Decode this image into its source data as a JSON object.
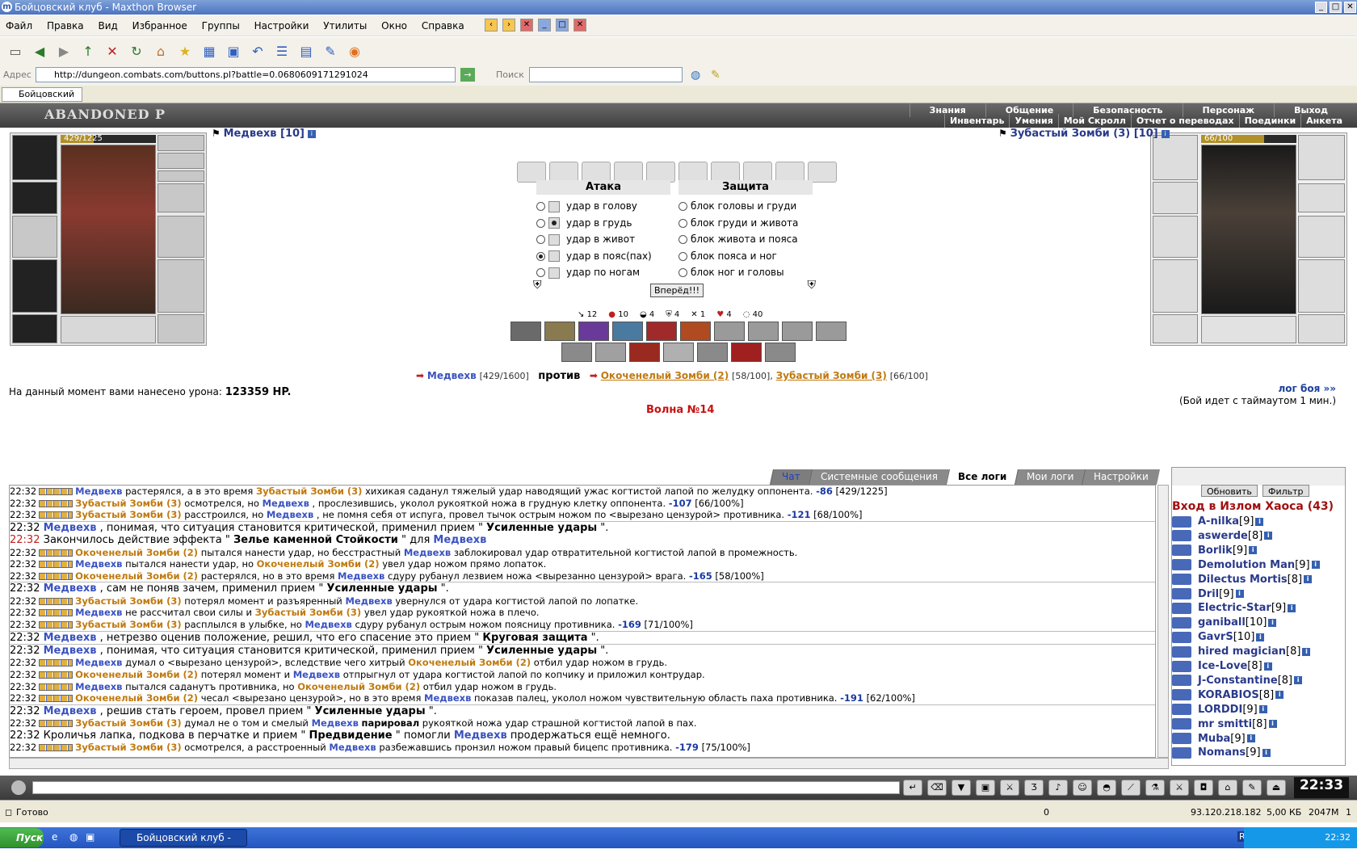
{
  "window": {
    "title": "Бойцовский клуб - Maxthon Browser",
    "app_icon": "maxthon-icon"
  },
  "menu": [
    "Файл",
    "Правка",
    "Вид",
    "Избранное",
    "Группы",
    "Настройки",
    "Утилиты",
    "Окно",
    "Справка"
  ],
  "address": {
    "label": "Адрес",
    "url": "http://dungeon.combats.com/buttons.pl?battle=0.0680609171291024",
    "search_label": "Поиск",
    "search_value": ""
  },
  "tab": {
    "label": "Бойцовский ..."
  },
  "game_header": {
    "logo": "ABANDONED P",
    "nav_top": [
      "Знания",
      "Общение",
      "Безопасность",
      "Персонаж",
      "Выход"
    ],
    "nav_bottom": [
      "Инвентарь",
      "Умения",
      "Мой Скролл",
      "Отчет о переводах",
      "Поединки",
      "Анкета"
    ]
  },
  "player": {
    "name": "Медвехв [10]",
    "hp": "429/1225",
    "hp_fraction": 0.35
  },
  "enemy": {
    "name": "Зубастый Зомби (3) [10]",
    "hp": "66/100",
    "hp_fraction": 0.66
  },
  "attack": {
    "title": "Атака",
    "options": [
      "удар в голову",
      "удар в грудь",
      "удар в живот",
      "удар в пояс(пах)",
      "удар по ногам"
    ],
    "selected": 3
  },
  "defense": {
    "title": "Защита",
    "options": [
      "блок головы и груди",
      "блок груди и живота",
      "блок живота и пояса",
      "блок пояса и ног",
      "блок ног и головы"
    ],
    "selected": -1
  },
  "go_button": "Вперёд!!!",
  "stats": [
    "12",
    "10",
    "4",
    "4",
    "1",
    "4",
    "40"
  ],
  "versus": {
    "player": "Медвехв",
    "player_hp": "[429/1600]",
    "vs": "против",
    "enemy1": "Окоченелый Зомби (2)",
    "enemy1_hp": "[58/100],",
    "enemy2": "Зубастый Зомби (3)",
    "enemy2_hp": "[66/100]"
  },
  "damage": {
    "label": "На данный момент вами нанесено урона:",
    "value": "123359 HP."
  },
  "wave": "Волна №14",
  "log_link": "лог боя »»",
  "timeout_text": "(Бой идет с таймаутом 1 мин.)",
  "chat_tabs": [
    "Чат",
    "Системные сообщения",
    "Все логи",
    "Мои логи",
    "Настройки"
  ],
  "chat_log": [
    {
      "t": "22:32",
      "sq": true,
      "parts": [
        [
          "b1",
          "Медвехв"
        ],
        [
          "",
          "растерялся, а в это время"
        ],
        [
          "b2",
          "Зубастый Зомби (3)"
        ],
        [
          "",
          "хихикая саданул тяжелый удар наводящий ужас когтистой лапой по желудку оппонента."
        ],
        [
          "dmg",
          "-86"
        ],
        [
          "",
          "[429/1225]"
        ]
      ]
    },
    {
      "t": "22:32",
      "sq": true,
      "parts": [
        [
          "b2",
          "Зубастый Зомби (3)"
        ],
        [
          "",
          "осмотрелся, но"
        ],
        [
          "b1",
          "Медвехв"
        ],
        [
          "",
          ", прослезившись, уколол рукояткой ножа в грудную клетку оппонента."
        ],
        [
          "dmg",
          "-107"
        ],
        [
          "",
          "[66/100%]"
        ]
      ]
    },
    {
      "t": "22:32",
      "sq": true,
      "parts": [
        [
          "b2",
          "Зубастый Зомби (3)"
        ],
        [
          "",
          "расстроился, но"
        ],
        [
          "b1",
          "Медвехв"
        ],
        [
          "",
          ", не помня себя от испуга, провел тычок острым ножом по <вырезано цензурой> противника."
        ],
        [
          "dmg",
          "-121"
        ],
        [
          "",
          "[68/100%]"
        ]
      ]
    },
    {
      "t": "22:32",
      "big": true,
      "sep": true,
      "parts": [
        [
          "b1",
          "Медвехв"
        ],
        [
          "",
          ", понимая, что ситуация становится критической, применил прием \""
        ],
        [
          "bk",
          "Усиленные удары"
        ],
        [
          "",
          "\"."
        ]
      ]
    },
    {
      "t": "22:32",
      "big": true,
      "red": true,
      "parts": [
        [
          "",
          "Закончилось действие эффекта \""
        ],
        [
          "bk",
          "Зелье каменной Стойкости"
        ],
        [
          "",
          "\" для"
        ],
        [
          "b1",
          "Медвехв"
        ]
      ]
    },
    {
      "t": "22:32",
      "sq": true,
      "parts": [
        [
          "b2",
          "Окоченелый Зомби (2)"
        ],
        [
          "",
          "пытался нанести удар, но бесстрастный"
        ],
        [
          "b1",
          "Медвехв"
        ],
        [
          "",
          "заблокировал удар отвратительной когтистой лапой в промежность."
        ]
      ]
    },
    {
      "t": "22:32",
      "sq": true,
      "parts": [
        [
          "b1",
          "Медвехв"
        ],
        [
          "",
          "пытался нанести удар, но"
        ],
        [
          "b2",
          "Окоченелый Зомби (2)"
        ],
        [
          "",
          "увел удар ножом прямо лопаток."
        ]
      ]
    },
    {
      "t": "22:32",
      "sq": true,
      "parts": [
        [
          "b2",
          "Окоченелый Зомби (2)"
        ],
        [
          "",
          "растерялся, но в это время"
        ],
        [
          "b1",
          "Медвехв"
        ],
        [
          "",
          "сдуру рубанул лезвием ножа <вырезанно цензурой> врага."
        ],
        [
          "dmg",
          "-165"
        ],
        [
          "",
          "[58/100%]"
        ]
      ]
    },
    {
      "t": "22:32",
      "big": true,
      "sep": true,
      "parts": [
        [
          "b1",
          "Медвехв"
        ],
        [
          "",
          ", сам не поняв зачем, применил прием \""
        ],
        [
          "bk",
          "Усиленные удары"
        ],
        [
          "",
          "\"."
        ]
      ]
    },
    {
      "t": "22:32",
      "sq": true,
      "parts": [
        [
          "b2",
          "Зубастый Зомби (3)"
        ],
        [
          "",
          "потерял момент и разъяренный"
        ],
        [
          "b1",
          "Медвехв"
        ],
        [
          "",
          "увернулся от удара когтистой лапой по лопатке."
        ]
      ]
    },
    {
      "t": "22:32",
      "sq": true,
      "parts": [
        [
          "b1",
          "Медвехв"
        ],
        [
          "",
          "не рассчитал свои силы и"
        ],
        [
          "b2",
          "Зубастый Зомби (3)"
        ],
        [
          "",
          "увел удар рукояткой ножа в плечо."
        ]
      ]
    },
    {
      "t": "22:32",
      "sq": true,
      "parts": [
        [
          "b2",
          "Зубастый Зомби (3)"
        ],
        [
          "",
          "расплылся в улыбке, но"
        ],
        [
          "b1",
          "Медвехв"
        ],
        [
          "",
          "сдуру рубанул острым ножом поясницу противника."
        ],
        [
          "dmg",
          "-169"
        ],
        [
          "",
          "[71/100%]"
        ]
      ]
    },
    {
      "t": "22:32",
      "big": true,
      "sep": true,
      "parts": [
        [
          "b1",
          "Медвехв"
        ],
        [
          "",
          ", нетрезво оценив положение, решил, что его спасение это прием \""
        ],
        [
          "bk",
          "Круговая защита"
        ],
        [
          "",
          "\"."
        ]
      ]
    },
    {
      "t": "22:32",
      "big": true,
      "sep": true,
      "parts": [
        [
          "b1",
          "Медвехв"
        ],
        [
          "",
          ", понимая, что ситуация становится критической, применил прием \""
        ],
        [
          "bk",
          "Усиленные удары"
        ],
        [
          "",
          "\"."
        ]
      ]
    },
    {
      "t": "22:32",
      "sq": true,
      "parts": [
        [
          "b1",
          "Медвехв"
        ],
        [
          "",
          "думал о <вырезано цензурой>, вследствие чего хитрый"
        ],
        [
          "b2",
          "Окоченелый Зомби (2)"
        ],
        [
          "",
          "отбил удар ножом в грудь."
        ]
      ]
    },
    {
      "t": "22:32",
      "sq": true,
      "parts": [
        [
          "b2",
          "Окоченелый Зомби (2)"
        ],
        [
          "",
          "потерял момент и"
        ],
        [
          "b1",
          "Медвехв"
        ],
        [
          "",
          "отпрыгнул от удара когтистой лапой по копчику и приложил контрудар."
        ]
      ]
    },
    {
      "t": "22:32",
      "sq": true,
      "parts": [
        [
          "b1",
          "Медвехв"
        ],
        [
          "",
          "пытался саданутъ противника, но"
        ],
        [
          "b2",
          "Окоченелый Зомби (2)"
        ],
        [
          "",
          "отбил удар ножом в грудь."
        ]
      ]
    },
    {
      "t": "22:32",
      "sq": true,
      "parts": [
        [
          "b2",
          "Окоченелый Зомби (2)"
        ],
        [
          "",
          "чесал <вырезано цензурой>, но в это время"
        ],
        [
          "b1",
          "Медвехв"
        ],
        [
          "",
          "показав палец, уколол ножом чувствительную область паха противника."
        ],
        [
          "dmg",
          "-191"
        ],
        [
          "",
          "[62/100%]"
        ]
      ]
    },
    {
      "t": "22:32",
      "big": true,
      "sep": true,
      "parts": [
        [
          "b1",
          "Медвехв"
        ],
        [
          "",
          ", решив стать героем, провел прием \""
        ],
        [
          "bk",
          "Усиленные удары"
        ],
        [
          "",
          "\"."
        ]
      ]
    },
    {
      "t": "22:32",
      "sq": true,
      "parts": [
        [
          "b2",
          "Зубастый Зомби (3)"
        ],
        [
          "",
          "думал не о том и смелый"
        ],
        [
          "b1",
          "Медвехв"
        ],
        [
          "bk",
          "парировал"
        ],
        [
          "",
          "рукояткой ножа удар страшной когтистой лапой в пах."
        ]
      ]
    },
    {
      "t": "22:32",
      "big": true,
      "parts": [
        [
          "",
          "Кроличья лапка, подкова в перчатке и прием \""
        ],
        [
          "bk",
          "Предвидение"
        ],
        [
          "",
          "\" помогли"
        ],
        [
          "b1",
          "Медвехв"
        ],
        [
          "",
          "продержаться ещё немного."
        ]
      ]
    },
    {
      "t": "22:32",
      "sq": true,
      "parts": [
        [
          "b2",
          "Зубастый Зомби (3)"
        ],
        [
          "",
          "осмотрелся, а расстроенный"
        ],
        [
          "b1",
          "Медвехв"
        ],
        [
          "",
          "разбежавшись пронзил ножом правый бицепс противника."
        ],
        [
          "dmg",
          "-179"
        ],
        [
          "",
          "[75/100%]"
        ]
      ]
    }
  ],
  "online": {
    "refresh": "Обновить",
    "filter": "Фильтр",
    "title": "Вход в Излом Хаоса (43)",
    "users": [
      [
        "A-nilka",
        "[9]"
      ],
      [
        "aswerde",
        "[8]"
      ],
      [
        "Borlik",
        "[9]"
      ],
      [
        "Demolution Man",
        "[9]"
      ],
      [
        "Dilectus Mortis",
        "[8]"
      ],
      [
        "Dril",
        "[9]"
      ],
      [
        "Electric-Star",
        "[9]"
      ],
      [
        "ganiball",
        "[10]"
      ],
      [
        "GavrS",
        "[10]"
      ],
      [
        "hired magician",
        "[8]"
      ],
      [
        "Ice-Love",
        "[8]"
      ],
      [
        "J-Constantine",
        "[8]"
      ],
      [
        "KORABIOS",
        "[8]"
      ],
      [
        "LORDDI",
        "[9]"
      ],
      [
        "mr smitti",
        "[8]"
      ],
      [
        "Muba",
        "[9]"
      ],
      [
        "Nomans",
        "[9]"
      ]
    ]
  },
  "clock": "22:33",
  "status": {
    "ready": "Готово",
    "count": "0",
    "ip": "93.120.218.182",
    "size": "5,00 КБ",
    "mem": "2047М",
    "page": "1"
  },
  "taskbar": {
    "start": "Пуск",
    "item": "Бойцовский клуб - М...",
    "lang": "RL",
    "time": "22:32"
  }
}
